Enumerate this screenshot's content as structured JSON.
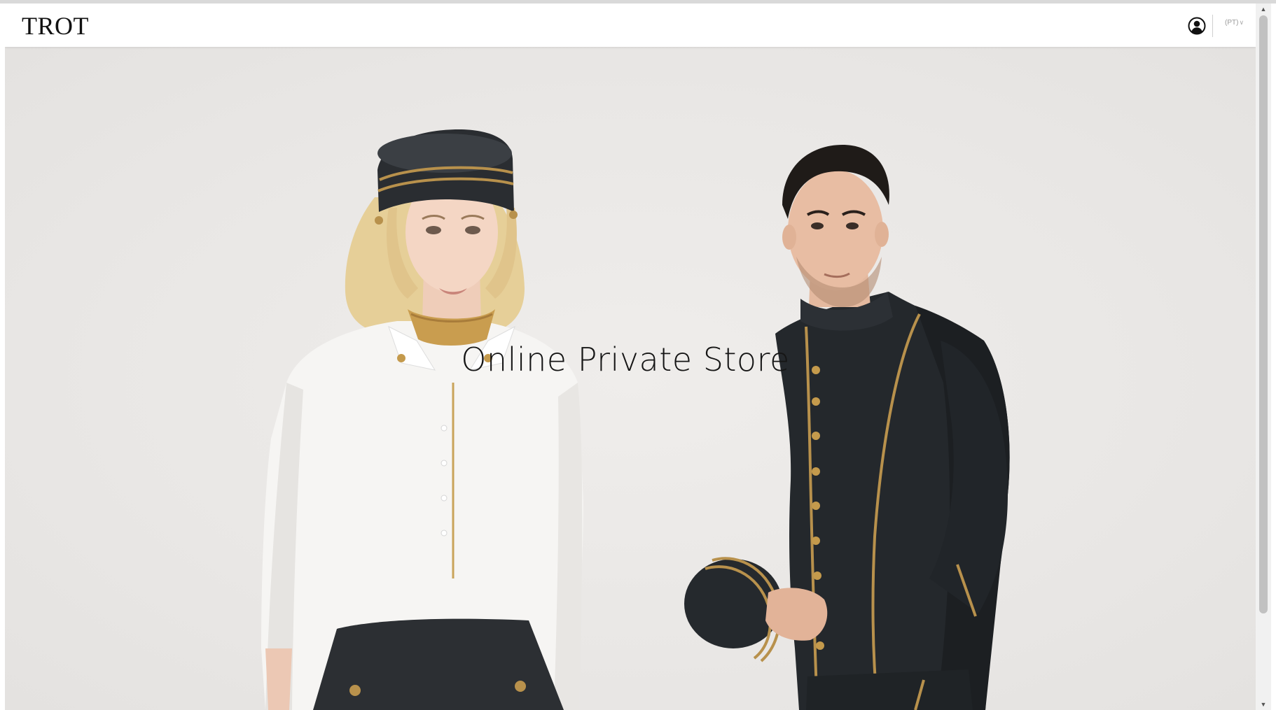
{
  "header": {
    "logo_text": "TROT",
    "account_icon": "user-circle-icon",
    "language_label": "(PT)",
    "language_chevron": "chevron-down-icon"
  },
  "hero": {
    "title": "Online Private Store",
    "image_description_icon": "hero-photo"
  },
  "scrollbar": {
    "up_glyph": "▲",
    "down_glyph": "▼"
  },
  "colors": {
    "hero_background": "#ebe9e8",
    "header_background": "#ffffff",
    "text": "#151515",
    "uniform_dark": "#23272b",
    "gold_trim": "#b8914c"
  }
}
